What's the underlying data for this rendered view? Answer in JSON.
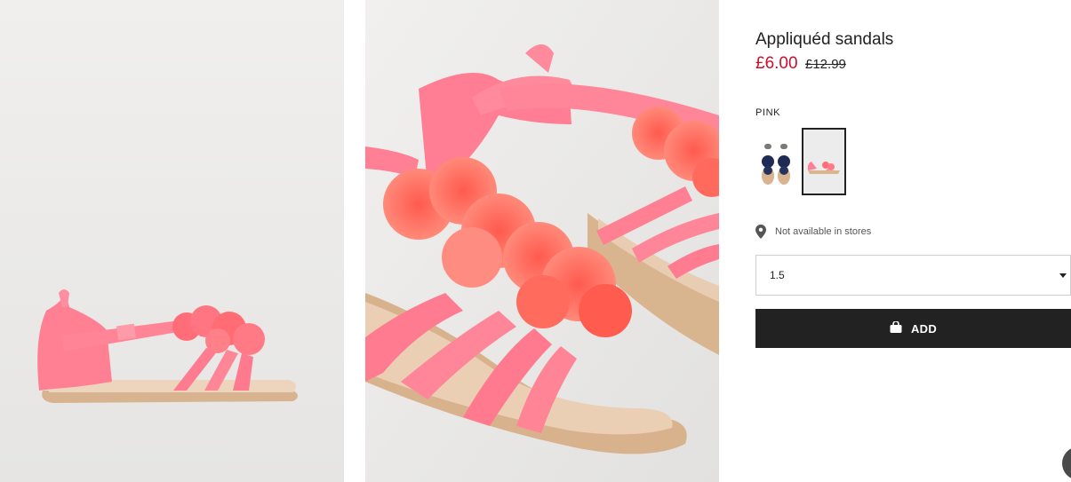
{
  "product": {
    "title": "Appliquéd sandals",
    "price_sale": "£6.00",
    "price_original": "£12.99"
  },
  "color": {
    "label": "PINK",
    "swatches": [
      {
        "name": "navy",
        "selected": false
      },
      {
        "name": "pink",
        "selected": true
      }
    ]
  },
  "availability": {
    "text": "Not available in stores",
    "icon": "location-pin-icon"
  },
  "size_select": {
    "value": "1.5"
  },
  "add_button": {
    "label": "ADD",
    "icon": "shopping-bag-icon"
  },
  "colors": {
    "accent_price": "#c8102e",
    "button_bg": "#222222",
    "product_pink": "#ff7a8f"
  }
}
